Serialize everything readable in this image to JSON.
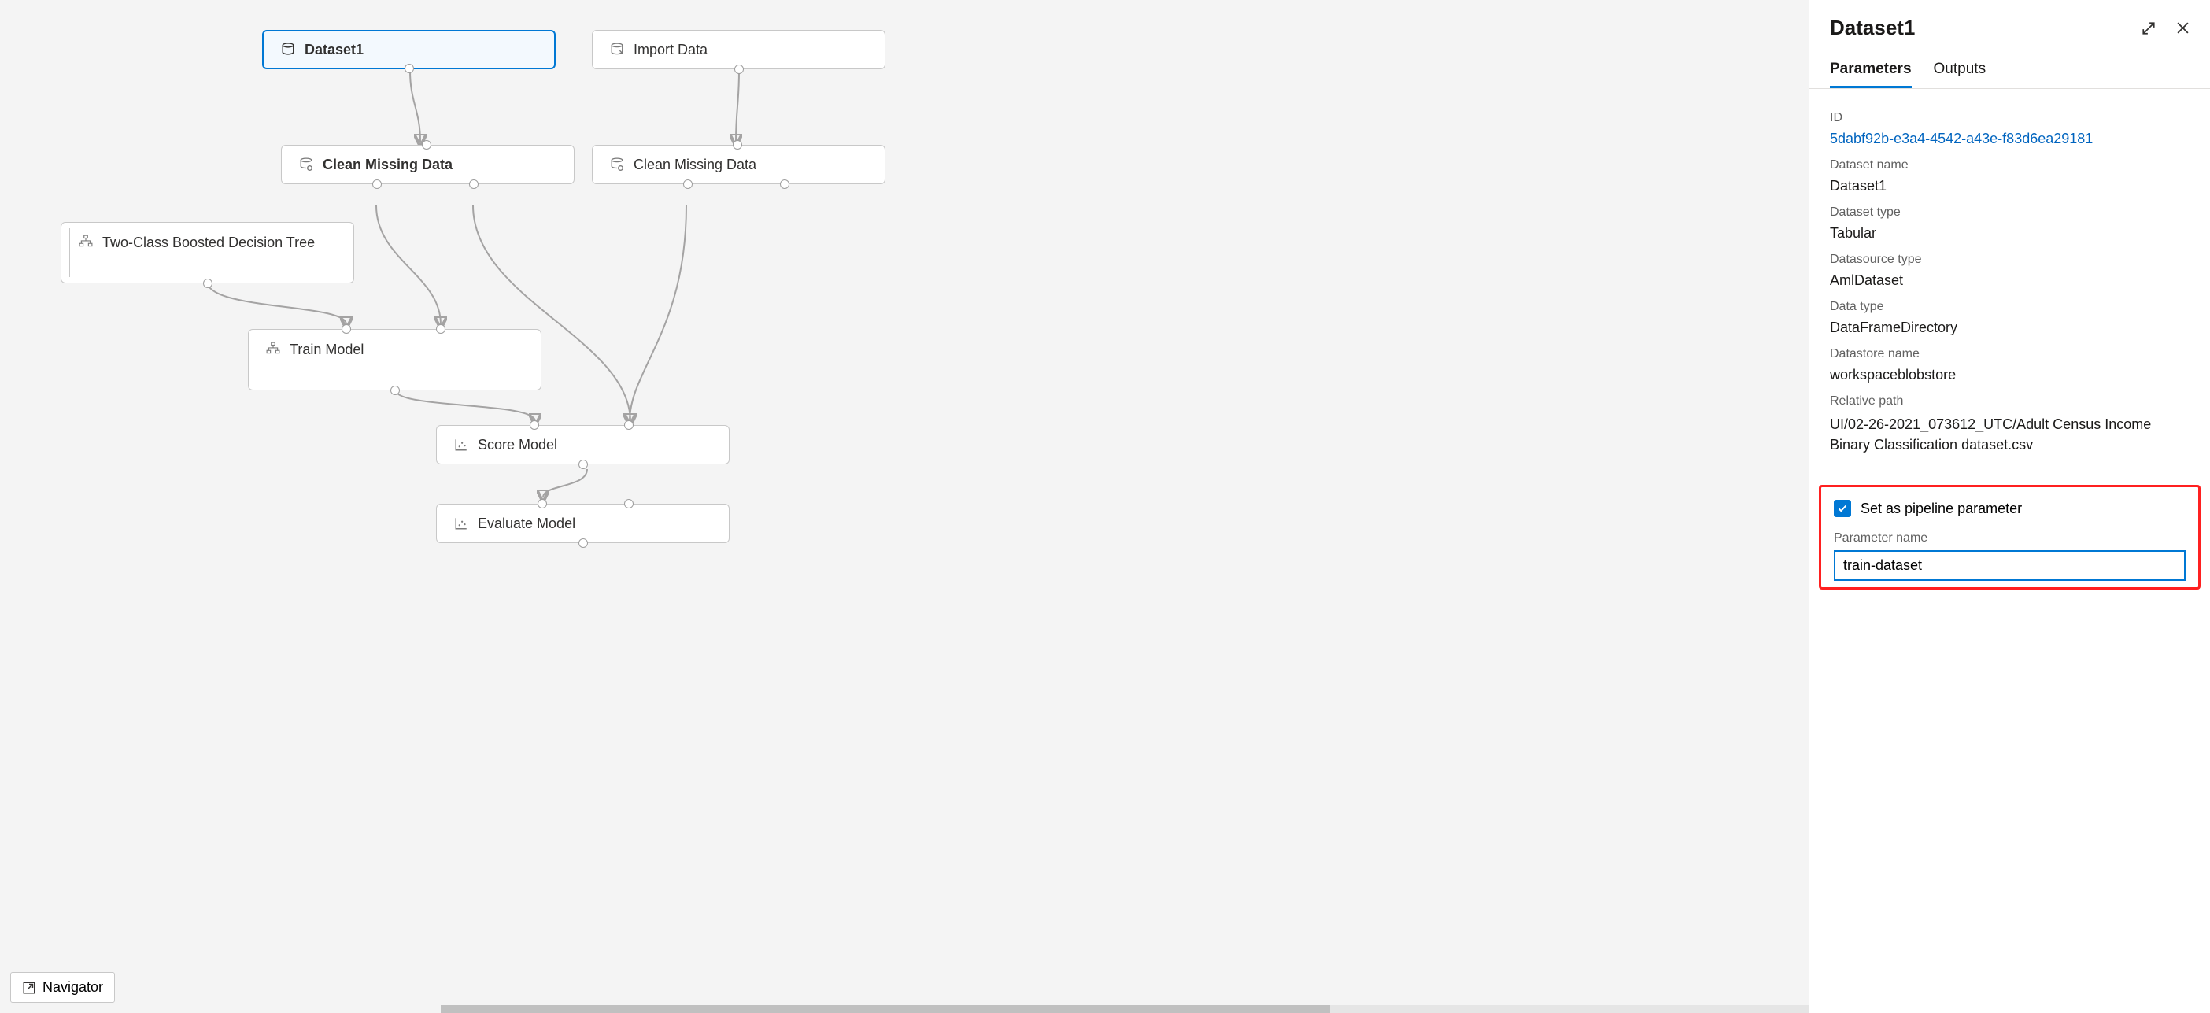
{
  "canvas": {
    "nodes": {
      "dataset1": "Dataset1",
      "import_data": "Import Data",
      "clean_missing_a": "Clean Missing Data",
      "clean_missing_b": "Clean Missing Data",
      "boosted_tree": "Two-Class Boosted Decision Tree",
      "train_model": "Train Model",
      "score_model": "Score Model",
      "evaluate_model": "Evaluate Model"
    },
    "navigator": "Navigator"
  },
  "panel": {
    "title": "Dataset1",
    "tabs": {
      "parameters": "Parameters",
      "outputs": "Outputs"
    },
    "fields": {
      "id_label": "ID",
      "id_value": "5dabf92b-e3a4-4542-a43e-f83d6ea29181",
      "dataset_name_label": "Dataset name",
      "dataset_name_value": "Dataset1",
      "dataset_type_label": "Dataset type",
      "dataset_type_value": "Tabular",
      "datasource_type_label": "Datasource type",
      "datasource_type_value": "AmlDataset",
      "data_type_label": "Data type",
      "data_type_value": "DataFrameDirectory",
      "datastore_name_label": "Datastore name",
      "datastore_name_value": "workspaceblobstore",
      "relative_path_label": "Relative path",
      "relative_path_value": "UI/02-26-2021_073612_UTC/Adult Census Income Binary Classification dataset.csv"
    },
    "pipeline_param": {
      "checkbox_label": "Set as pipeline parameter",
      "name_label": "Parameter name",
      "name_value": "train-dataset"
    }
  }
}
